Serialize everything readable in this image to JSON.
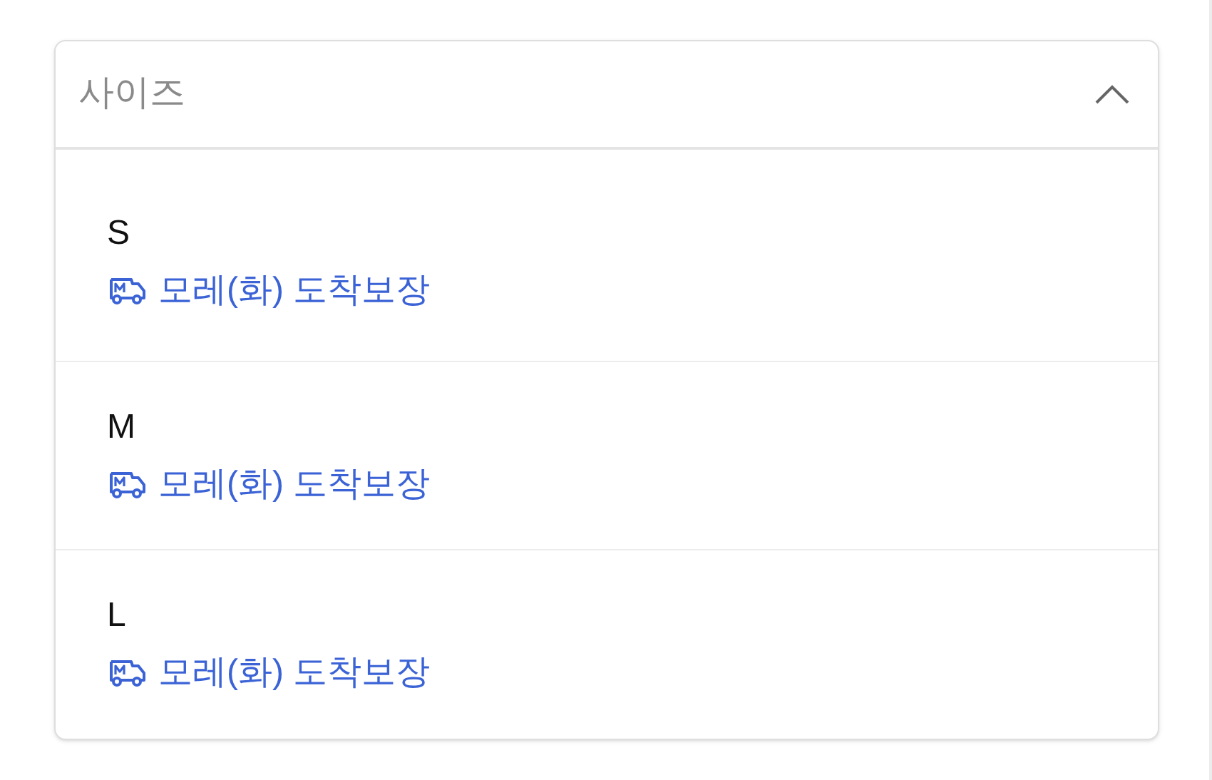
{
  "dropdown": {
    "label": "사이즈",
    "expanded": true,
    "options": [
      {
        "size": "S",
        "delivery": "모레(화) 도착보장"
      },
      {
        "size": "M",
        "delivery": "모레(화) 도착보장"
      },
      {
        "size": "L",
        "delivery": "모레(화) 도착보장"
      }
    ]
  }
}
